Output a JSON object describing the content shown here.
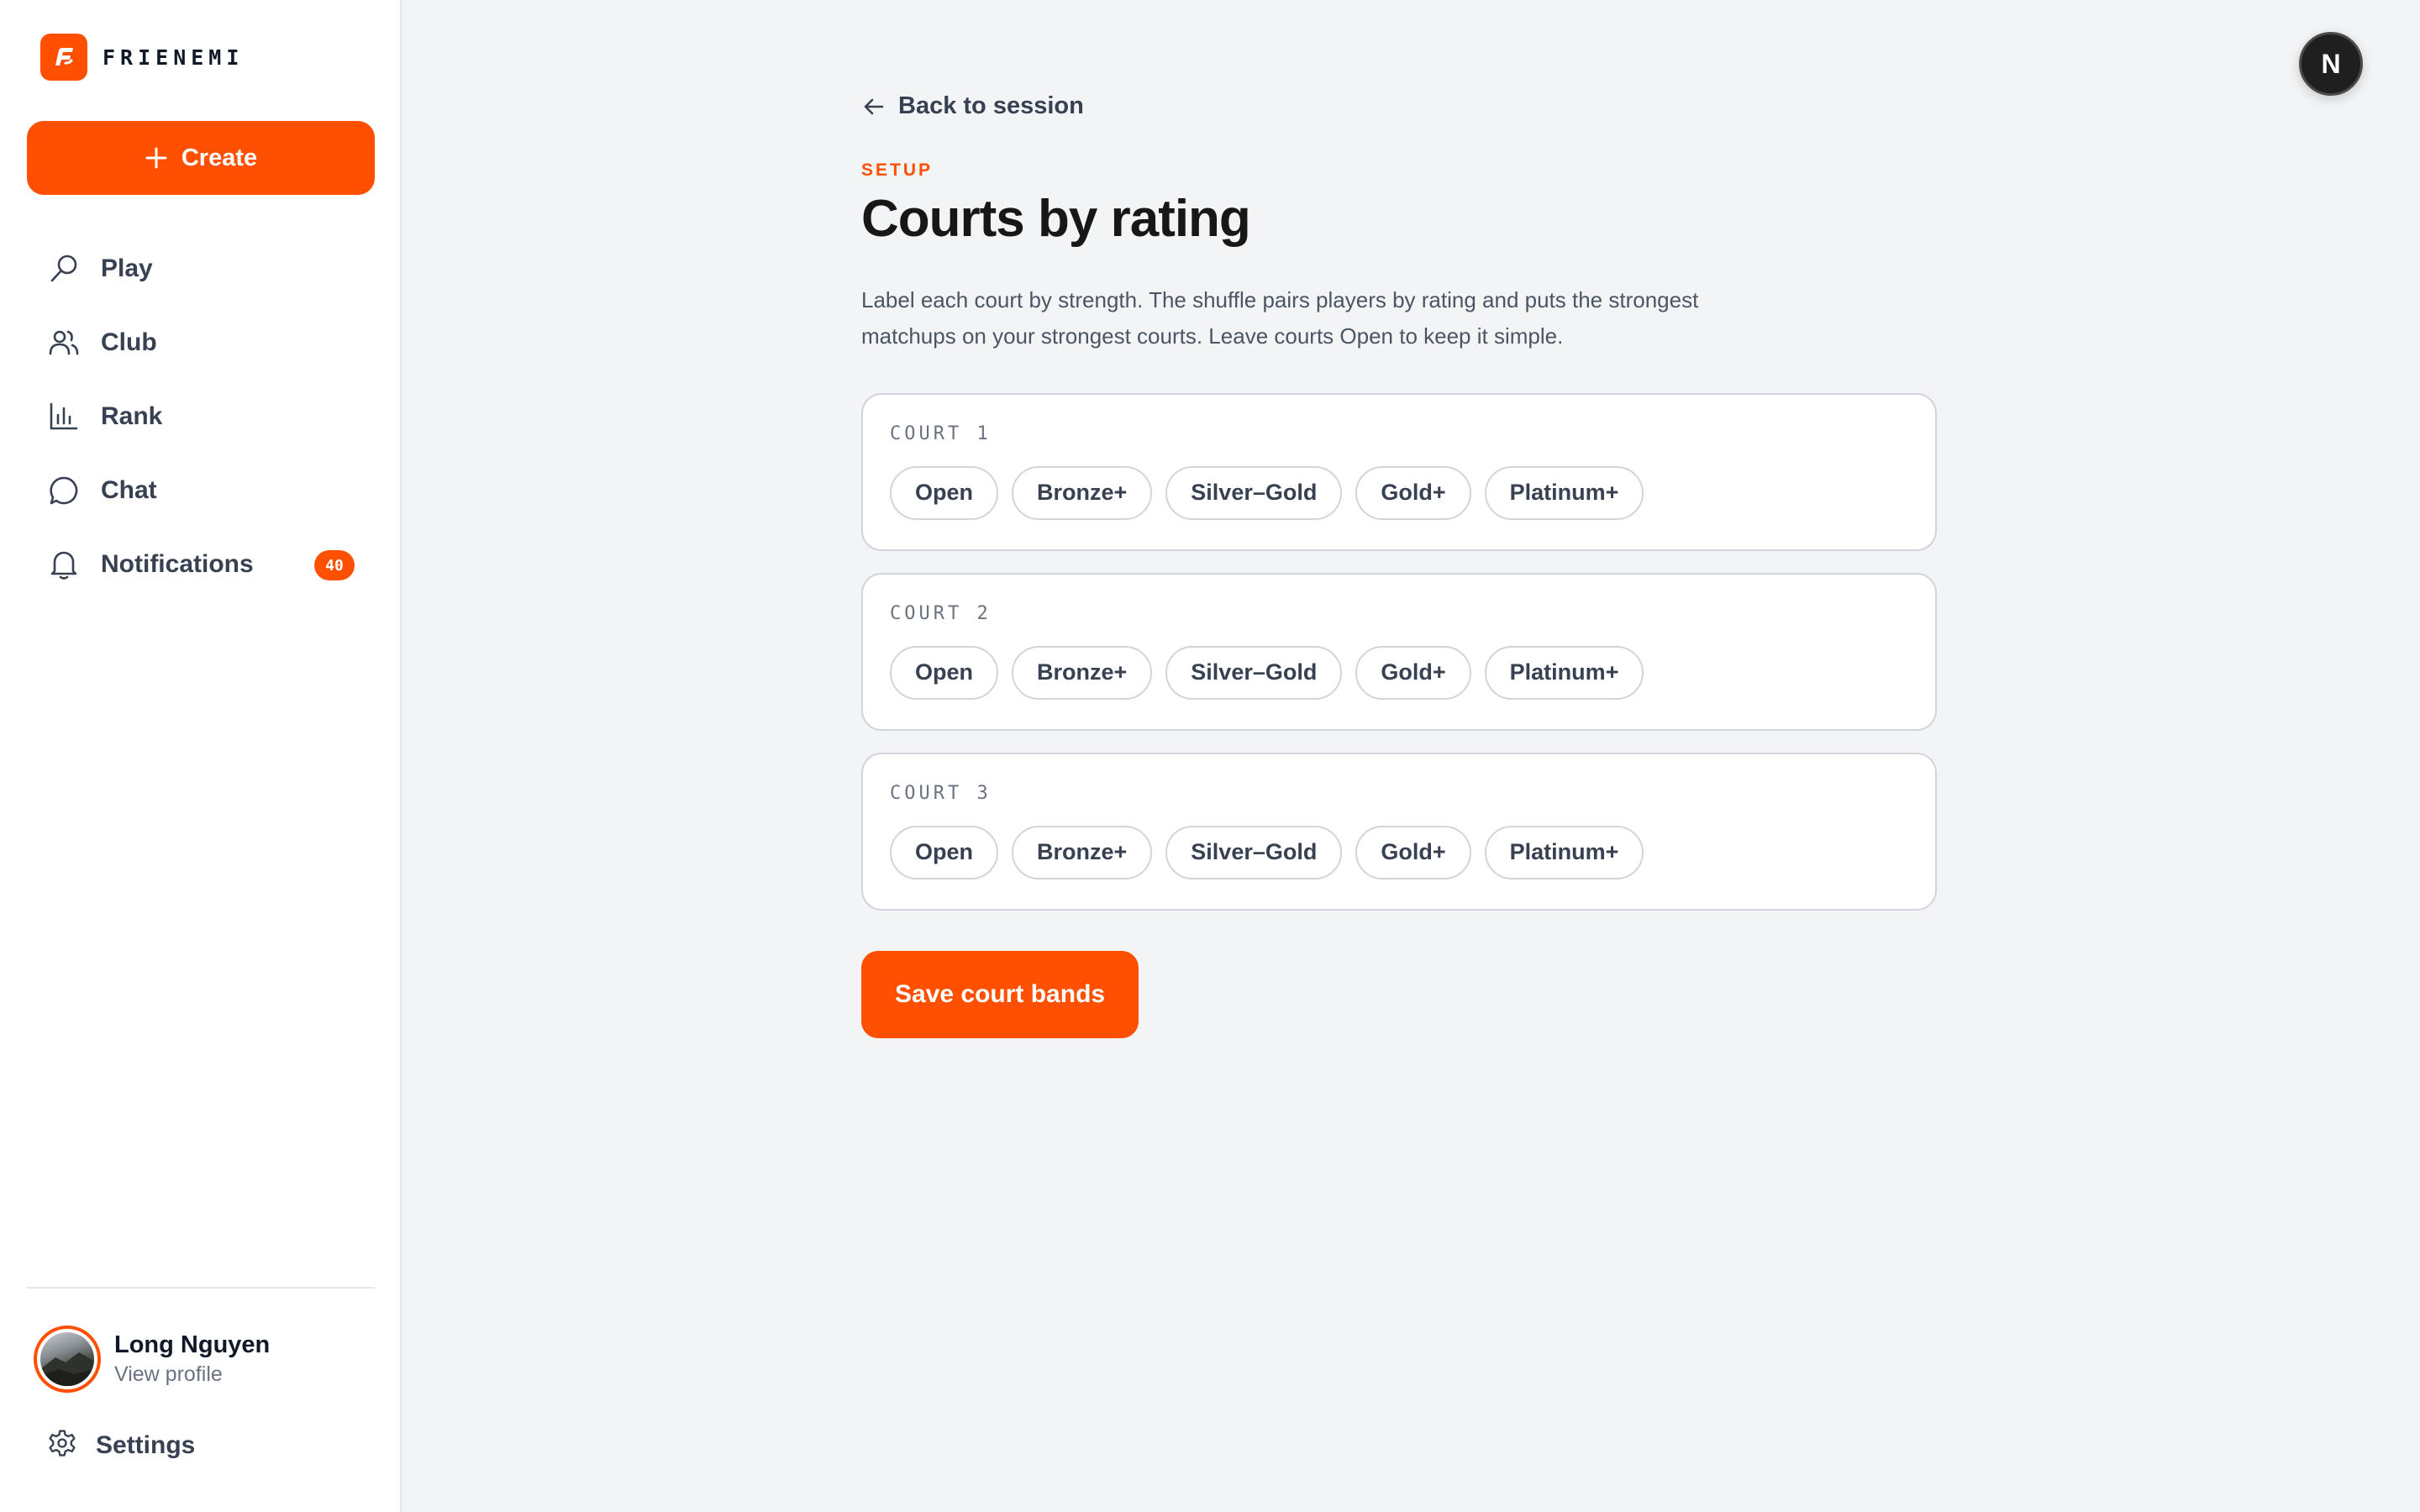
{
  "brand": {
    "name": "FRIENEMI",
    "logo_icon": "frienemi-logo-icon",
    "accent_color": "#fe5000"
  },
  "sidebar": {
    "create_label": "Create",
    "items": [
      {
        "label": "Play",
        "icon": "racket-icon"
      },
      {
        "label": "Club",
        "icon": "users-icon"
      },
      {
        "label": "Rank",
        "icon": "bar-chart-icon"
      },
      {
        "label": "Chat",
        "icon": "chat-bubble-icon"
      },
      {
        "label": "Notifications",
        "icon": "bell-icon",
        "badge": "40"
      }
    ],
    "profile": {
      "name": "Long Nguyen",
      "link": "View profile"
    },
    "settings_label": "Settings"
  },
  "header": {
    "user_initial": "N"
  },
  "main": {
    "back_label": "Back to session",
    "eyebrow": "SETUP",
    "title": "Courts by rating",
    "description": "Label each court by strength. The shuffle pairs players by rating and puts the strongest matchups on your strongest courts. Leave courts Open to keep it simple.",
    "courts": [
      {
        "label": "COURT 1",
        "options": [
          "Open",
          "Bronze+",
          "Silver–Gold",
          "Gold+",
          "Platinum+"
        ]
      },
      {
        "label": "COURT 2",
        "options": [
          "Open",
          "Bronze+",
          "Silver–Gold",
          "Gold+",
          "Platinum+"
        ]
      },
      {
        "label": "COURT 3",
        "options": [
          "Open",
          "Bronze+",
          "Silver–Gold",
          "Gold+",
          "Platinum+"
        ]
      }
    ],
    "save_label": "Save court bands"
  }
}
